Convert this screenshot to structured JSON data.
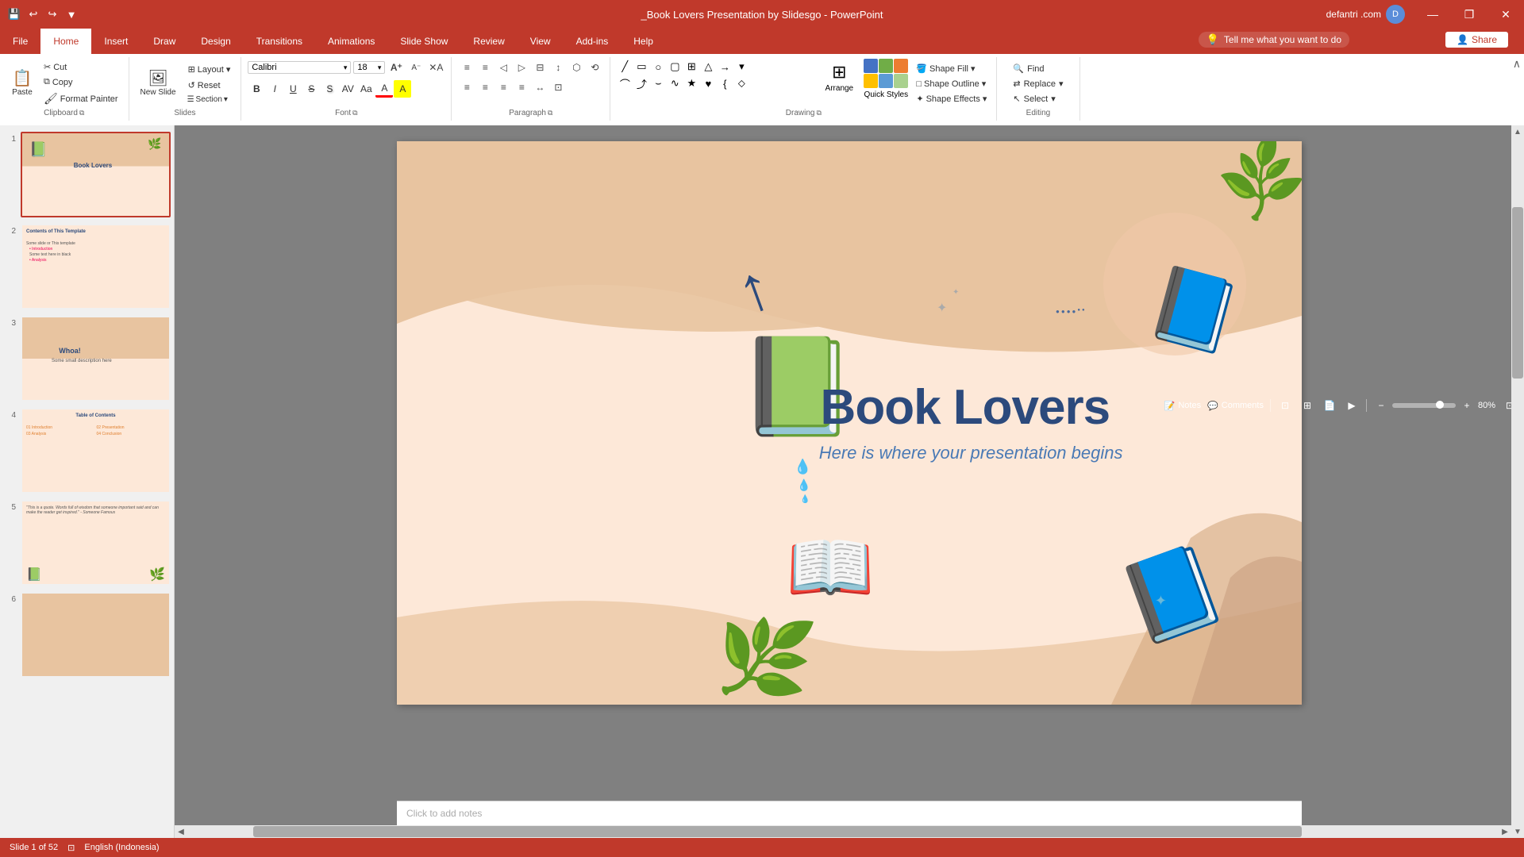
{
  "titlebar": {
    "title": "_Book Lovers Presentation by Slidesgo - PowerPoint",
    "user": "defantri .com",
    "minimize": "—",
    "restore": "❐",
    "close": "✕"
  },
  "qat": {
    "save": "💾",
    "undo": "↩",
    "redo": "↪",
    "customize": "▼"
  },
  "tabs": [
    "File",
    "Home",
    "Insert",
    "Draw",
    "Design",
    "Transitions",
    "Animations",
    "Slide Show",
    "Review",
    "View",
    "Add-ins",
    "Help"
  ],
  "active_tab": "Home",
  "tell_me": "Tell me what you want to do",
  "share": "Share",
  "ribbon": {
    "clipboard": {
      "label": "Clipboard",
      "paste": "Paste",
      "cut": "✂",
      "copy": "⧉",
      "format_painter": "🖌"
    },
    "slides": {
      "label": "Slides",
      "new_slide": "New Slide",
      "layout": "Layout",
      "reset": "Reset",
      "section": "Section"
    },
    "font": {
      "label": "Font",
      "family": "Calibri",
      "size": "18",
      "grow": "A",
      "shrink": "A",
      "clear": "A",
      "bold": "B",
      "italic": "I",
      "underline": "U",
      "strikethrough": "S",
      "shadow": "S",
      "spacing": "AV",
      "case": "Aa",
      "color": "A",
      "highlight": "A"
    },
    "paragraph": {
      "label": "Paragraph",
      "bullets": "≡",
      "numbered": "≡",
      "decrease": "◁",
      "increase": "▷",
      "cols": "⊟",
      "line_spacing": "↕",
      "align_left": "≡",
      "align_center": "≡",
      "align_right": "≡",
      "justify": "≡",
      "text_dir": "↔",
      "smartart": "⬡",
      "convert": "⟲"
    },
    "drawing": {
      "label": "Drawing",
      "arrange": "Arrange",
      "quick_styles": "Quick Styles",
      "shape_fill": "Shape Fill",
      "shape_outline": "Shape Outline",
      "shape_effects": "Shape Effects"
    },
    "editing": {
      "label": "Editing",
      "find": "Find",
      "replace": "Replace",
      "select": "Select"
    }
  },
  "slide": {
    "title": "Book Lovers",
    "subtitle": "Here is where your presentation begins"
  },
  "slides_panel": [
    {
      "number": "1",
      "active": true
    },
    {
      "number": "2",
      "active": false
    },
    {
      "number": "3",
      "active": false
    },
    {
      "number": "4",
      "active": false
    },
    {
      "number": "5",
      "active": false
    },
    {
      "number": "6",
      "active": false
    }
  ],
  "status_bar": {
    "slide_info": "Slide 1 of 52",
    "language": "English (Indonesia)",
    "notes": "Notes",
    "comments": "Comments"
  },
  "zoom": {
    "level": "80%",
    "fit": "⊡"
  },
  "notes_placeholder": "Click to add notes"
}
